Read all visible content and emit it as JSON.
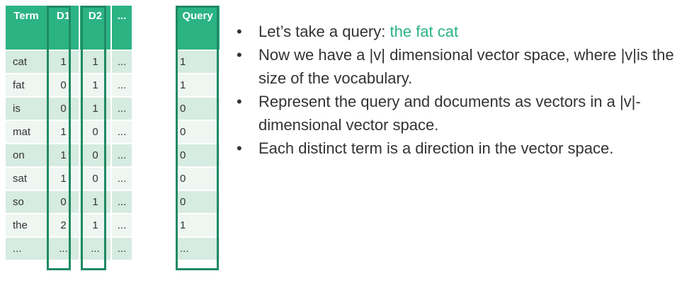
{
  "doc_table": {
    "headers": [
      "Term",
      "D1",
      "D2",
      "..."
    ],
    "rows": [
      [
        "cat",
        "1",
        "1",
        "..."
      ],
      [
        "fat",
        "0",
        "1",
        "..."
      ],
      [
        "is",
        "0",
        "1",
        "..."
      ],
      [
        "mat",
        "1",
        "0",
        "..."
      ],
      [
        "on",
        "1",
        "0",
        "..."
      ],
      [
        "sat",
        "1",
        "0",
        "..."
      ],
      [
        "so",
        "0",
        "1",
        "..."
      ],
      [
        "the",
        "2",
        "1",
        "..."
      ],
      [
        "...",
        "...",
        "...",
        "..."
      ]
    ]
  },
  "query_table": {
    "header": "Query",
    "values": [
      "1",
      "1",
      "0",
      "0",
      "0",
      "0",
      "0",
      "1",
      "..."
    ]
  },
  "bullets": [
    {
      "text": "Let’s take a query: ",
      "highlight": "the fat cat"
    },
    {
      "text": "Now we have a |v| dimensional vector space, where |v|is the size of the vocabulary.",
      "highlight": ""
    },
    {
      "text": "Represent the query and documents as vectors in a |v|-dimensional vector space.",
      "highlight": ""
    },
    {
      "text": "Each distinct term is a direction in the vector space.",
      "highlight": ""
    }
  ],
  "colors": {
    "header": "#2bb384",
    "highlight_box": "#1f8a63",
    "row_odd": "#d6ebe1",
    "row_even": "#eef6f2"
  }
}
